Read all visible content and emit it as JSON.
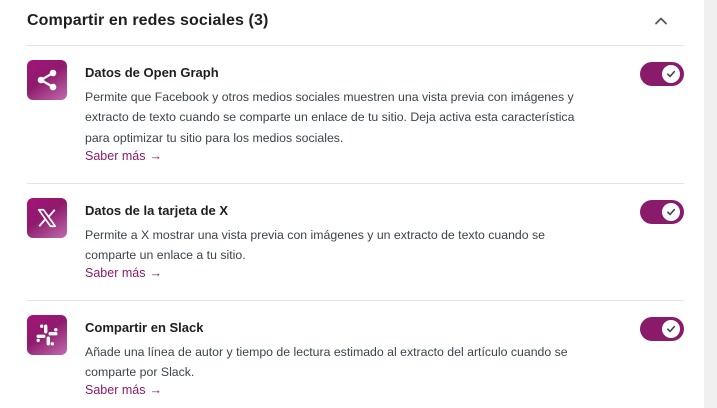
{
  "section": {
    "title": "Compartir en redes sociales (3)",
    "collapse_icon": "chevron-up-icon"
  },
  "features": [
    {
      "icon": "share-icon",
      "title": "Datos de Open Graph",
      "description_lines": [
        "Permite que Facebook y otros medios sociales muestren una vista previa con imágenes y",
        "extracto de texto cuando se comparte un enlace de tu sitio. Deja activa esta característica",
        "para optimizar tu sitio para los medios sociales."
      ],
      "learn_more": "Saber más",
      "enabled": true
    },
    {
      "icon": "x-logo-icon",
      "title": "Datos de la tarjeta de X",
      "description_lines": [
        "Permite a X mostrar una vista previa con imágenes y un extracto de texto cuando se",
        "comparte un enlace a tu sitio."
      ],
      "learn_more": "Saber más",
      "enabled": true
    },
    {
      "icon": "slack-icon",
      "title": "Compartir en Slack",
      "description_lines": [
        "Añade una línea de autor y tiempo de lectura estimado al extracto del artículo cuando se",
        "comparte por Slack."
      ],
      "learn_more": "Saber más",
      "enabled": true
    }
  ],
  "colors": {
    "accent": "#8a1a6a",
    "divider": "#e2e4e7",
    "text": "#1e1e1e",
    "muted_text": "#3c434a"
  },
  "arrow_glyph": "→"
}
